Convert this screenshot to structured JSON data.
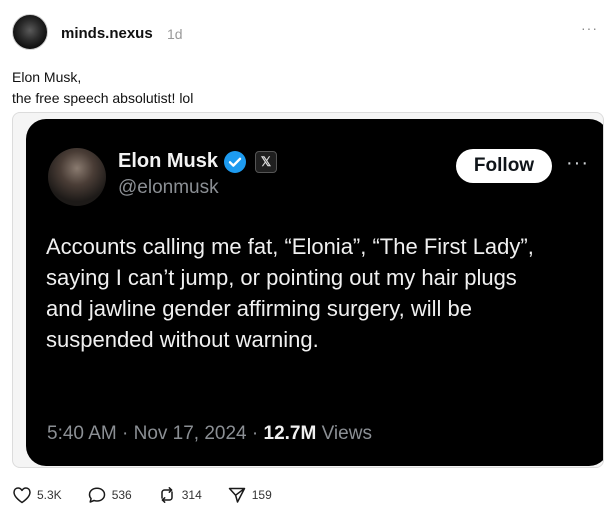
{
  "post": {
    "username": "minds.nexus",
    "time": "1d",
    "more": "···",
    "caption_lines": [
      "Elon Musk,",
      "the free speech absolutist! lol"
    ]
  },
  "embedded_tweet": {
    "name": "Elon Musk",
    "handle": "@elonmusk",
    "x_badge": "𝕏",
    "follow_label": "Follow",
    "more": "···",
    "text_lines": [
      "Accounts calling me fat, “Elonia”, “The First Lady”,",
      "saying I can’t jump, or pointing out my hair plugs",
      "and jawline gender affirming surgery, will be",
      "suspended without warning."
    ],
    "timestamp": "5:40 AM · Nov 17, 2024 · ",
    "views_count": "12.7M",
    "views_label": " Views",
    "verified_color": "#1d9bf0"
  },
  "actions": {
    "likes": "5.3K",
    "replies": "536",
    "reposts": "314",
    "shares": "159"
  }
}
